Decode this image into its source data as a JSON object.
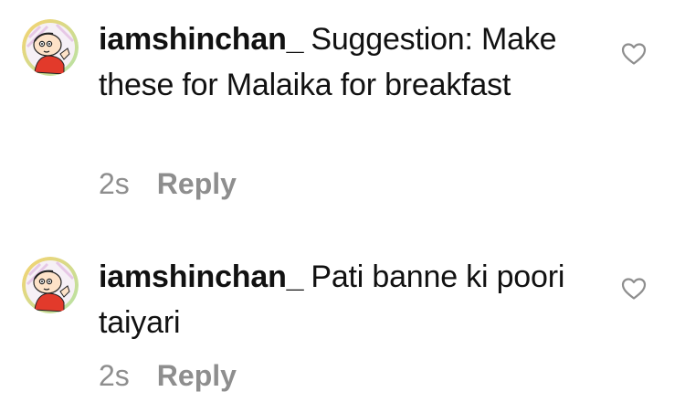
{
  "comments": [
    {
      "username": "iamshinchan_",
      "text": "Suggestion: Make these for Malaika for breakfast",
      "time": "2s",
      "reply_label": "Reply",
      "icons": {
        "avatar": "shinchan-avatar",
        "like": "heart-outline-icon"
      }
    },
    {
      "username": "iamshinchan_",
      "text": "Pati banne ki poori taiyari",
      "time": "2s",
      "reply_label": "Reply",
      "icons": {
        "avatar": "shinchan-avatar",
        "like": "heart-outline-icon"
      }
    }
  ],
  "colors": {
    "text": "#111111",
    "meta": "#8e8e8e",
    "avatar_ring_start": "#f7b84a",
    "avatar_ring_end": "#b5e3a8",
    "shirt_red": "#e23a2b"
  }
}
